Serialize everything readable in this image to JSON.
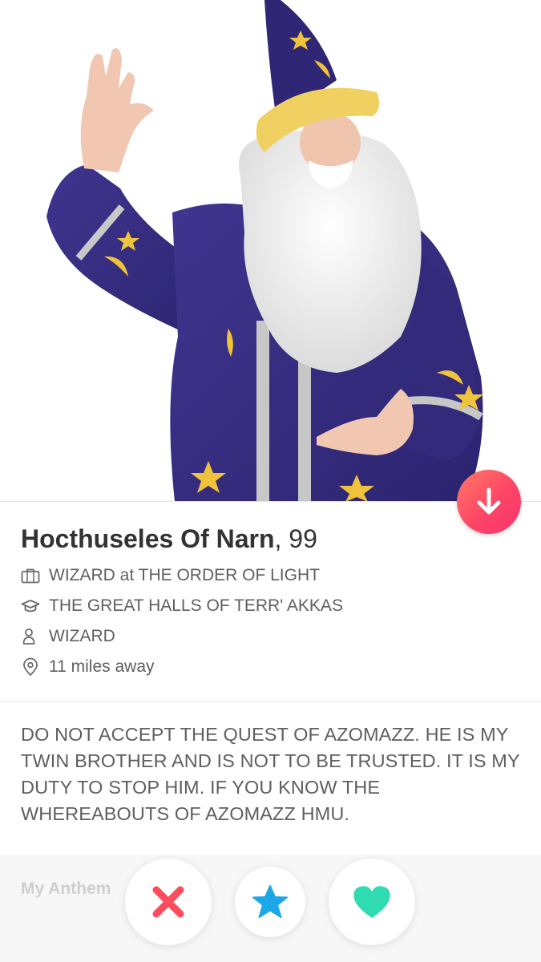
{
  "profile": {
    "name": "Hocthuseles Of Narn",
    "age": ", 99",
    "job": "WIZARD at THE ORDER OF LIGHT",
    "school": "THE GREAT HALLS OF TERR' AKKAS",
    "gender": "WIZARD",
    "distance": "11 miles away",
    "bio": "DO NOT ACCEPT THE QUEST OF AZOMAZZ. HE IS MY TWIN BROTHER AND IS NOT TO BE TRUSTED. IT IS MY DUTY TO STOP HIM. IF YOU KNOW THE WHEREABOUTS OF AZOMAZZ HMU."
  },
  "anthem": {
    "label": "My Anthem"
  },
  "icons": {
    "collapse": "arrow-down-icon",
    "job": "briefcase-icon",
    "school": "graduation-cap-icon",
    "gender": "person-icon",
    "distance": "location-pin-icon",
    "nope": "x-icon",
    "super_like": "star-icon",
    "like": "heart-icon"
  },
  "colors": {
    "collapse_gradient": [
      "#ff7a66",
      "#f5336d"
    ],
    "nope": "#fd4d5d",
    "super_like": "#1da6e8",
    "like": "#2fdbb0",
    "robe": "#3a2f86",
    "gold": "#f0c43c"
  }
}
